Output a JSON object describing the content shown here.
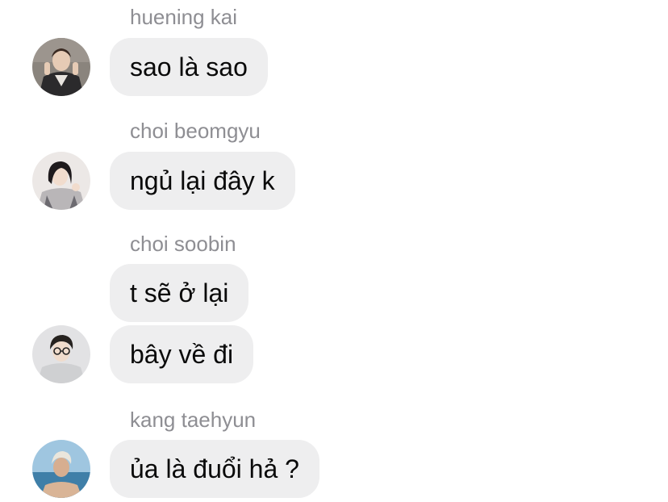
{
  "messages": [
    {
      "sender": "huening kai",
      "avatar_icon": "user-avatar-icon",
      "bubbles": [
        "sao là sao"
      ]
    },
    {
      "sender": "choi beomgyu",
      "avatar_icon": "user-avatar-icon",
      "bubbles": [
        "ngủ lại đây k"
      ]
    },
    {
      "sender": "choi soobin",
      "avatar_icon": "user-avatar-icon",
      "bubbles": [
        "t sẽ ở lại",
        "bây về đi"
      ]
    },
    {
      "sender": "kang taehyun",
      "avatar_icon": "user-avatar-icon",
      "bubbles": [
        "ủa là đuổi hả ?"
      ]
    }
  ],
  "colors": {
    "bubble_background": "#eeeeef",
    "sender_text": "#8e8e93",
    "message_text": "#0a0a0a"
  }
}
